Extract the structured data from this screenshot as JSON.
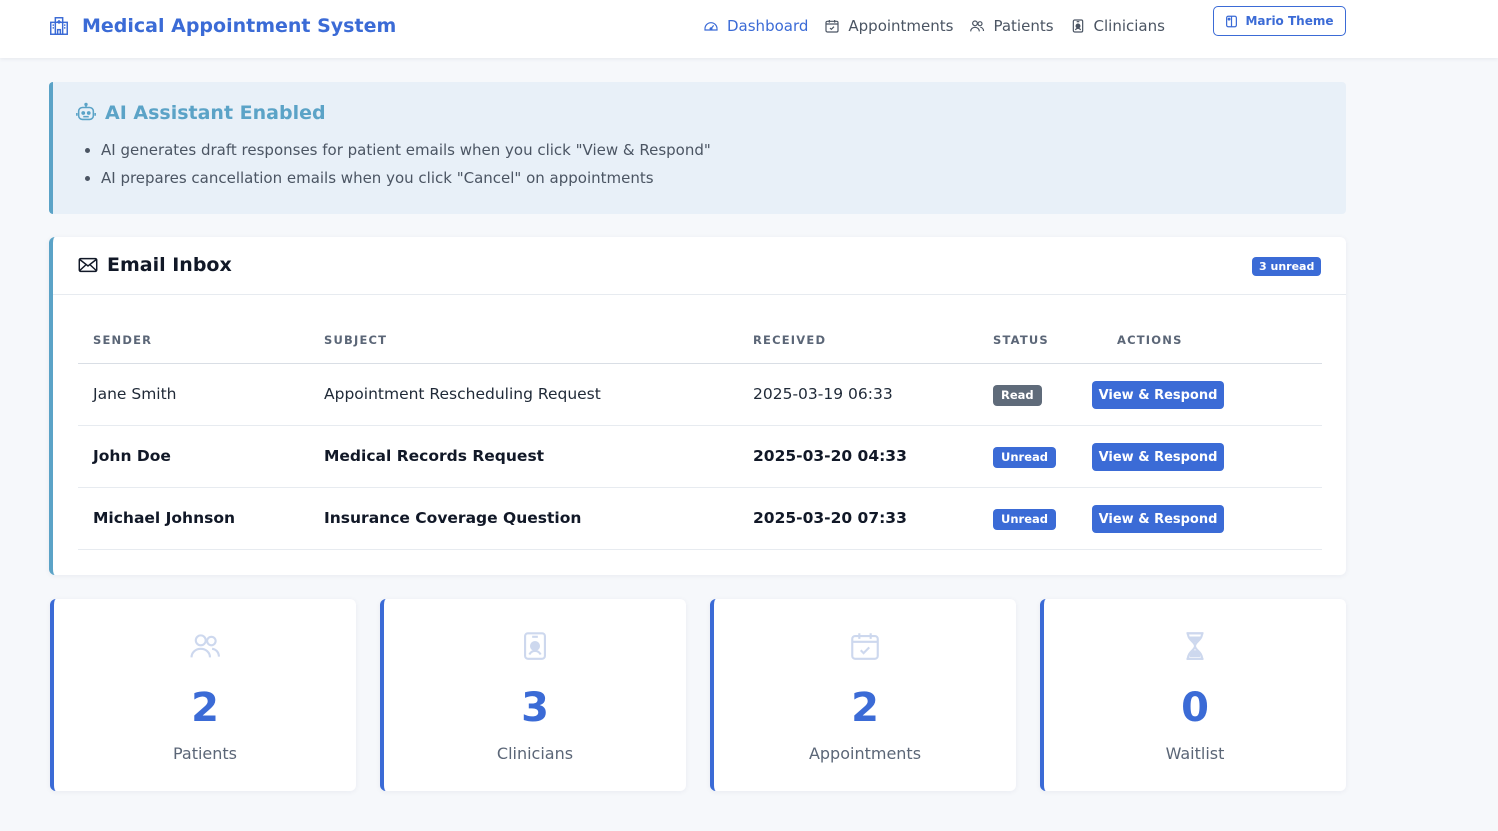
{
  "app": {
    "title": "Medical Appointment System"
  },
  "nav": {
    "items": [
      {
        "label": "Dashboard",
        "icon": "speedometer-icon",
        "active": true
      },
      {
        "label": "Appointments",
        "icon": "calendar-check-icon",
        "active": false
      },
      {
        "label": "Patients",
        "icon": "people-icon",
        "active": false
      },
      {
        "label": "Clinicians",
        "icon": "badge-icon",
        "active": false
      }
    ],
    "theme_button": "Mario Theme"
  },
  "ai_banner": {
    "title": "AI Assistant Enabled",
    "items": [
      "AI generates draft responses for patient emails when you click \"View & Respond\"",
      "AI prepares cancellation emails when you click \"Cancel\" on appointments"
    ]
  },
  "inbox": {
    "title": "Email Inbox",
    "unread_badge": "3 unread",
    "columns": [
      "SENDER",
      "SUBJECT",
      "RECEIVED",
      "STATUS",
      "ACTIONS"
    ],
    "rows": [
      {
        "sender": "Jane Smith",
        "subject": "Appointment Rescheduling Request",
        "received": "2025-03-19 06:33",
        "status": "Read",
        "action": "View & Respond"
      },
      {
        "sender": "John Doe",
        "subject": "Medical Records Request",
        "received": "2025-03-20 04:33",
        "status": "Unread",
        "action": "View & Respond"
      },
      {
        "sender": "Michael Johnson",
        "subject": "Insurance Coverage Question",
        "received": "2025-03-20 07:33",
        "status": "Unread",
        "action": "View & Respond"
      }
    ]
  },
  "stats": [
    {
      "value": "2",
      "label": "Patients",
      "icon": "people-icon"
    },
    {
      "value": "3",
      "label": "Clinicians",
      "icon": "badge-icon"
    },
    {
      "value": "2",
      "label": "Appointments",
      "icon": "calendar-check-icon"
    },
    {
      "value": "0",
      "label": "Waitlist",
      "icon": "hourglass-icon"
    }
  ],
  "colors": {
    "primary": "#3b6bd6",
    "info": "#5ba3c7",
    "banner_bg": "#e8f0f8",
    "read_badge": "#5f6b7a"
  }
}
